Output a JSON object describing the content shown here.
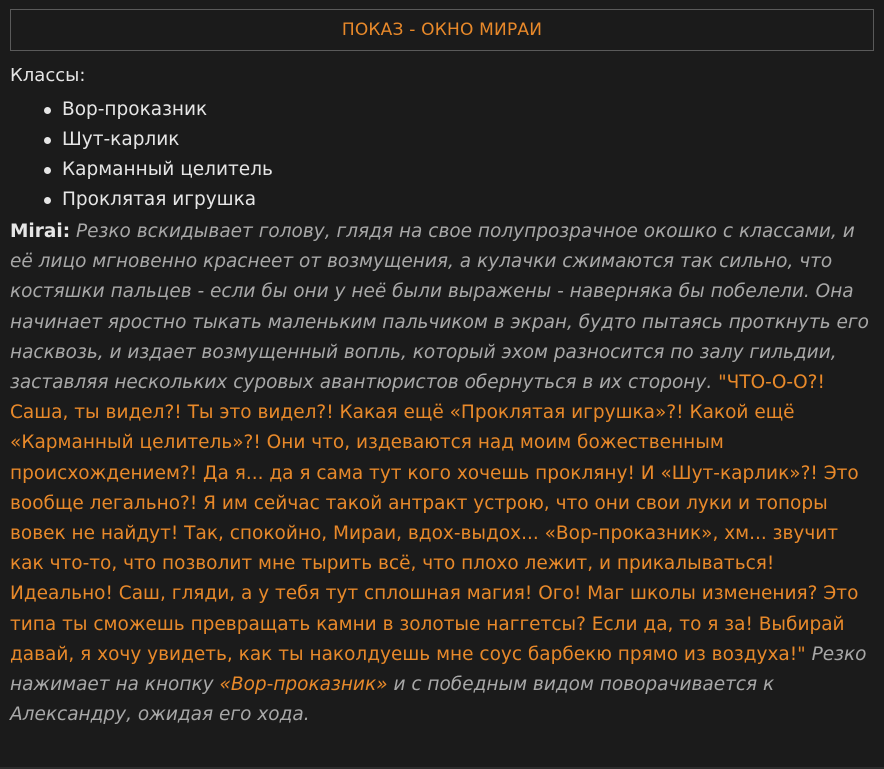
{
  "window": {
    "title": "ПОКАЗ - ОКНО МИРАИ"
  },
  "classes": {
    "label": "Классы:",
    "items": [
      "Вор-проказник",
      "Шут-карлик",
      "Карманный целитель",
      "Проклятая игрушка"
    ]
  },
  "message": {
    "speaker": "Mirai:",
    "action_1": "Резко вскидывает голову, глядя на свое полупрозрачное окошко с классами, и её лицо мгновенно краснеет от возмущения, а кулачки сжимаются так сильно, что костяшки пальцев - если бы они у неё были выражены - наверняка бы побелели. Она начинает яростно тыкать маленьким пальчиком в экран, будто пытаясь проткнуть его насквозь, и издает возмущенный вопль, который эхом разносится по залу гильдии, заставляя нескольких суровых авантюристов обернуться в их сторону.",
    "speech": "\"ЧТО-О-О?! Саша, ты видел?! Ты это видел?! Какая ещё «Проклятая игрушка»?! Какой ещё «Карманный целитель»?! Они что, издеваются над моим божественным происхождением?! Да я... да я сама тут кого хочешь прокляну! И «Шут-карлик»?! Это вообще легально?! Я им сейчас такой антракт устрою, что они свои луки и топоры вовек не найдут! Так, спокойно, Мираи, вдох-выдох... «Вор-проказник», хм... звучит как что-то, что позволит мне тырить всё, что плохо лежит, и прикалываться! Идеально! Саш, гляди, а у тебя тут сплошная магия! Ого! Маг школы изменения? Это типа ты сможешь превращать камни в золотые наггетсы? Если да, то я за! Выбирай давай, я хочу увидеть, как ты наколдуешь мне соус барбекю прямо из воздуха!\"",
    "action_2_before": "Резко нажимает на кнопку",
    "action_2_highlight": "«Вор-проказник»",
    "action_2_after": "и с победным видом поворачивается к Александру, ожидая его хода."
  }
}
